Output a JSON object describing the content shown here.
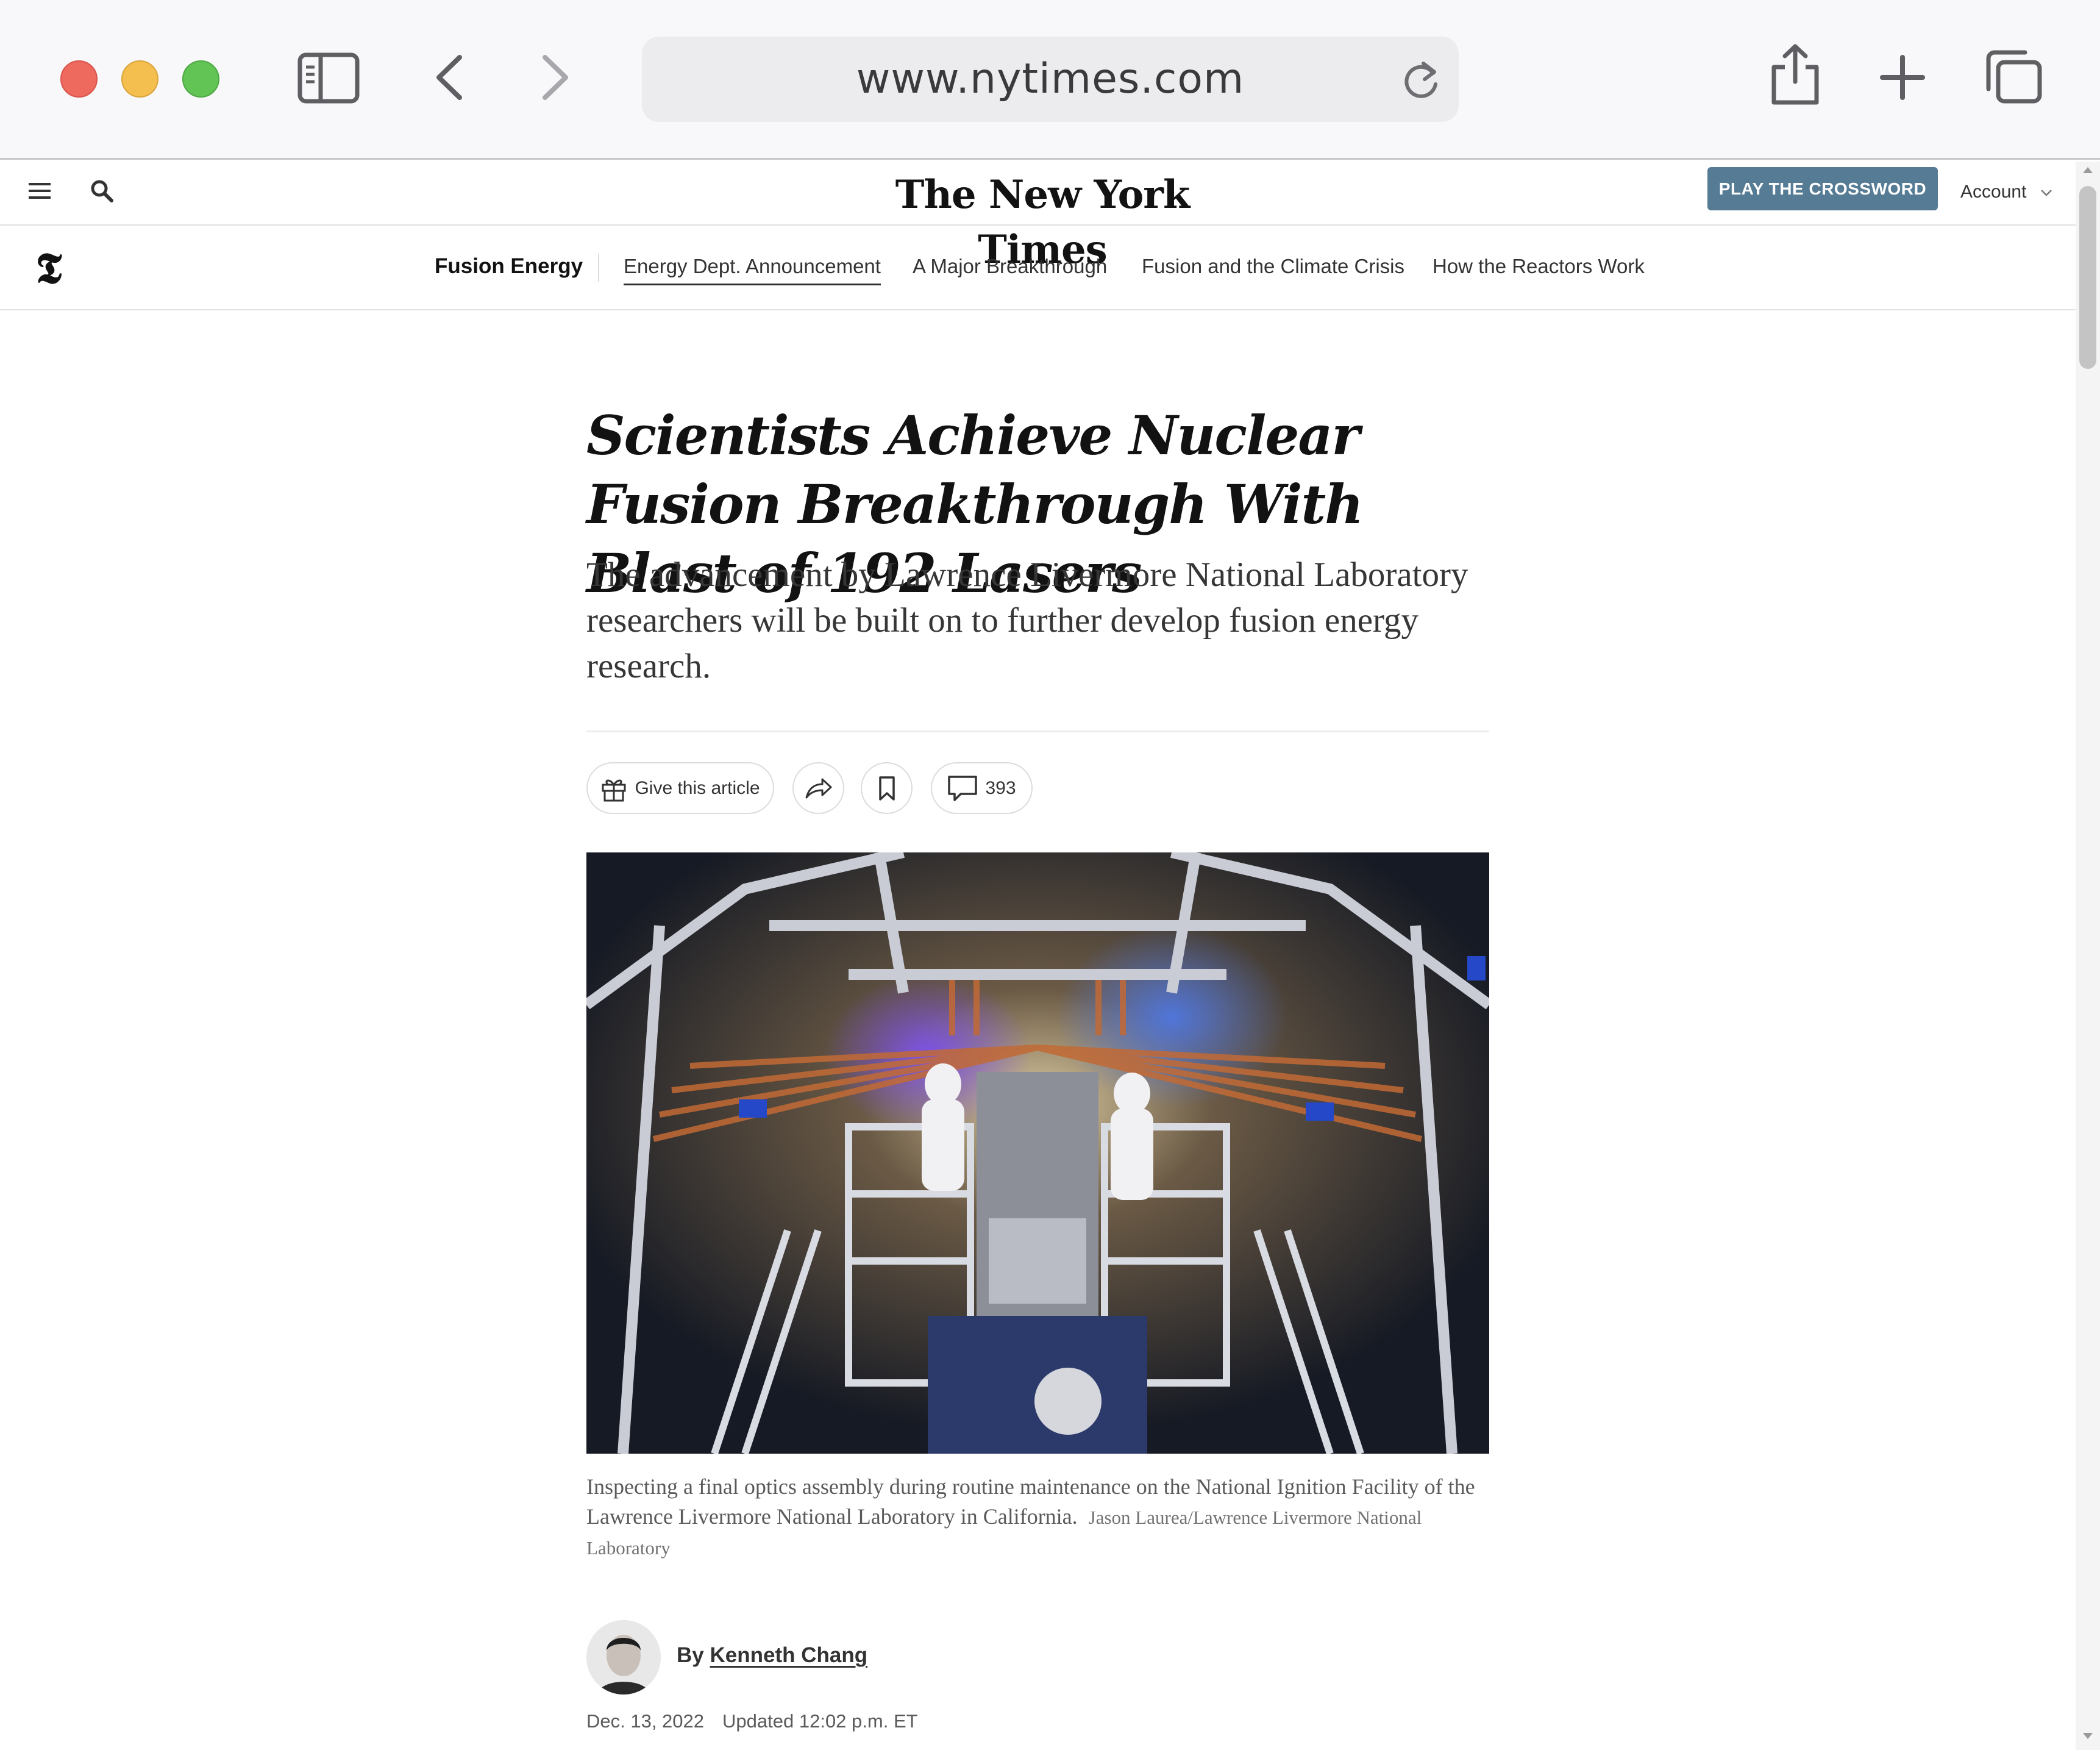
{
  "browser": {
    "url": "www.nytimes.com"
  },
  "masthead": {
    "logo": "The New York Times",
    "crossword_button": "PLAY THE CROSSWORD",
    "account_label": "Account"
  },
  "section_nav": {
    "section_title": "Fusion Energy",
    "links": [
      {
        "label": "Energy Dept. Announcement"
      },
      {
        "label": "A Major Breakthrough"
      },
      {
        "label": "Fusion and the Climate Crisis"
      },
      {
        "label": "How the Reactors Work"
      }
    ]
  },
  "article": {
    "headline": "Scientists Achieve Nuclear Fusion Breakthrough With Blast of 192 Lasers",
    "summary": "The advancement by Lawrence Livermore National Laboratory researchers will be built on to further develop fusion energy research.",
    "actions": {
      "gift_label": "Give this article",
      "comment_count": "393"
    },
    "caption": "Inspecting a final optics assembly during routine maintenance on the National Ignition Facility of the Lawrence Livermore National Laboratory in California.",
    "photo_credit": "Jason Laurea/Lawrence Livermore National Laboratory",
    "byline_prefix": "By",
    "author": "Kenneth Chang",
    "published": "Dec. 13, 2022",
    "updated": "Updated 12:02 p.m. ET"
  },
  "colors": {
    "crossword_button": "#567b95",
    "traffic_red": "#ee6a5e",
    "traffic_yellow": "#f5bf4f",
    "traffic_green": "#61c454"
  },
  "icons": {
    "sidebar": "sidebar-icon",
    "back": "chevron-left-icon",
    "forward": "chevron-right-icon",
    "reload": "reload-icon",
    "share": "share-icon",
    "new_tab": "plus-icon",
    "tabs": "tabs-overview-icon",
    "menu": "hamburger-menu-icon",
    "search": "search-icon",
    "gift": "gift-icon",
    "article_share": "share-arrow-icon",
    "bookmark": "bookmark-icon",
    "comments": "comment-icon"
  }
}
